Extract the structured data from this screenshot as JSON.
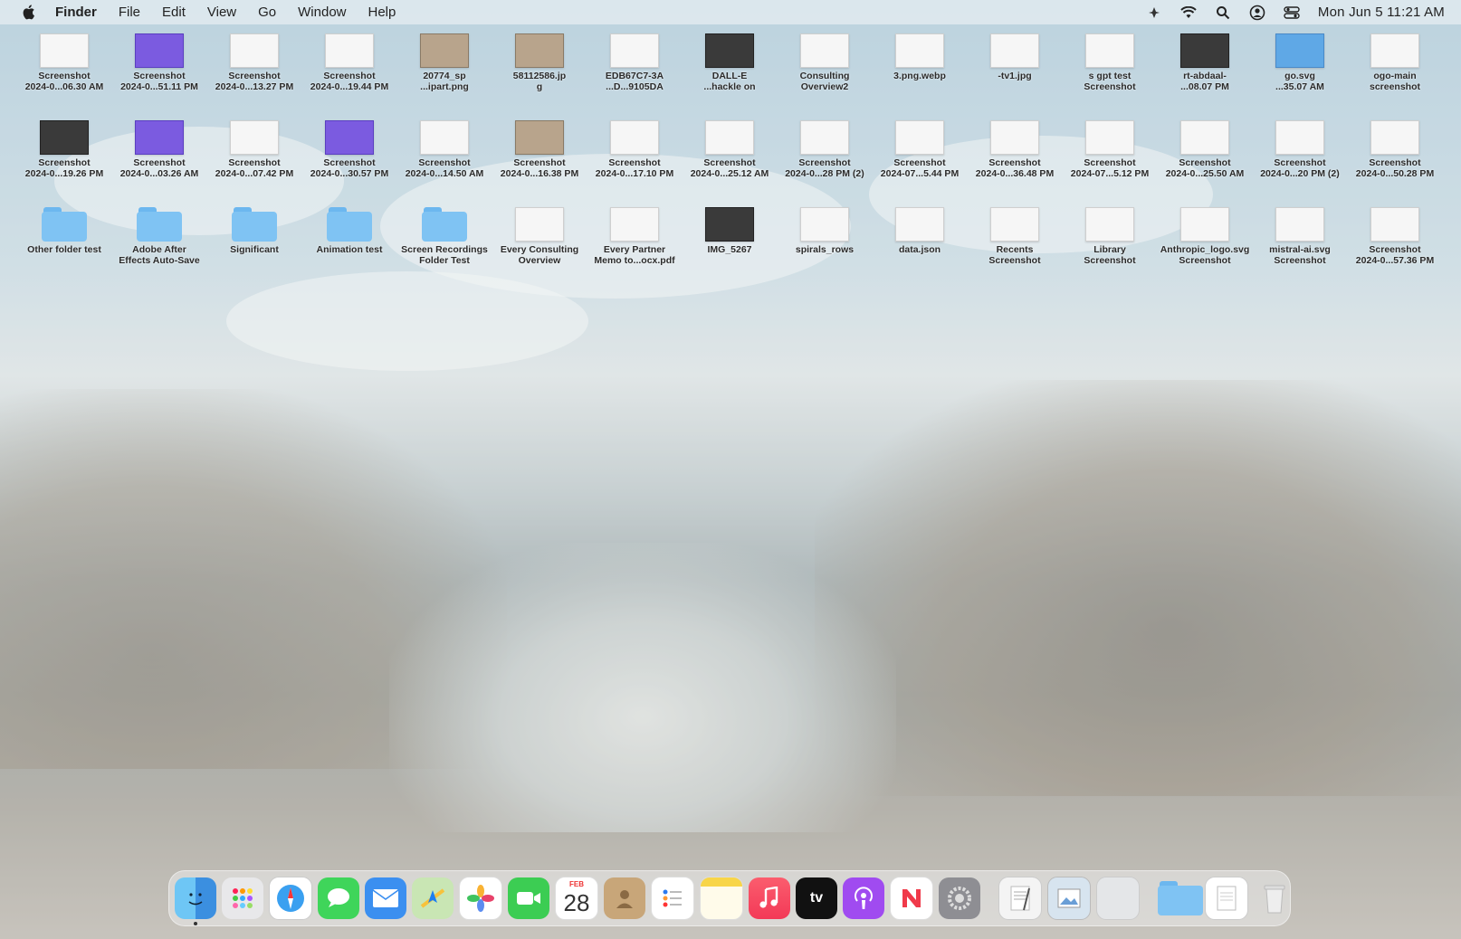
{
  "menubar": {
    "menus": [
      "Finder",
      "File",
      "Edit",
      "View",
      "Go",
      "Window",
      "Help"
    ],
    "clock": "Mon Jun 5  11:21 AM",
    "status_icons": [
      "airdrop-icon",
      "wifi-icon",
      "search-icon",
      "user-icon",
      "control-center-icon"
    ]
  },
  "desktop": {
    "items": [
      {
        "label": "Screenshot\n2024-0...06.30 AM",
        "kind": "thumb"
      },
      {
        "label": "Screenshot\n2024-0...51.11 PM",
        "kind": "purple"
      },
      {
        "label": "Screenshot\n2024-0...13.27 PM",
        "kind": "thumb"
      },
      {
        "label": "Screenshot\n2024-0...19.44 PM",
        "kind": "thumb"
      },
      {
        "label": "20774_sp\n...ipart.png",
        "kind": "photo"
      },
      {
        "label": "58112586.jp\ng",
        "kind": "photo"
      },
      {
        "label": "EDB67C7-3A\n...D...9105DA",
        "kind": "thumb"
      },
      {
        "label": "DALL-E\n...hackle on",
        "kind": "dark"
      },
      {
        "label": "Consulting\nOverview2",
        "kind": "thumb"
      },
      {
        "label": "3.png.webp",
        "kind": "thumb"
      },
      {
        "label": "-tv1.jpg",
        "kind": "thumb"
      },
      {
        "label": "s gpt test\nScreenshot",
        "kind": "thumb"
      },
      {
        "label": "rt-abdaal-\n...08.07 PM",
        "kind": "dark"
      },
      {
        "label": "go.svg\n...35.07 AM",
        "kind": "blue"
      },
      {
        "label": "ogo-main\nscreenshot",
        "kind": "thumb"
      },
      {
        "label": "Screenshot\n2024-0...19.26 PM",
        "kind": "dark"
      },
      {
        "label": "Screenshot\n2024-0...03.26 AM",
        "kind": "purple"
      },
      {
        "label": "Screenshot\n2024-0...07.42 PM",
        "kind": "thumb"
      },
      {
        "label": "Screenshot\n2024-0...30.57 PM",
        "kind": "purple"
      },
      {
        "label": "Screenshot\n2024-0...14.50 AM",
        "kind": "thumb"
      },
      {
        "label": "Screenshot\n2024-0...16.38 PM",
        "kind": "photo"
      },
      {
        "label": "Screenshot\n2024-0...17.10 PM",
        "kind": "thumb"
      },
      {
        "label": "Screenshot\n2024-0...25.12 AM",
        "kind": "thumb"
      },
      {
        "label": "Screenshot\n2024-0...28 PM (2)",
        "kind": "thumb"
      },
      {
        "label": "Screenshot\n2024-07...5.44 PM",
        "kind": "thumb"
      },
      {
        "label": "Screenshot\n2024-0...36.48 PM",
        "kind": "thumb"
      },
      {
        "label": "Screenshot\n2024-07...5.12 PM",
        "kind": "thumb"
      },
      {
        "label": "Screenshot\n2024-0...25.50 AM",
        "kind": "thumb"
      },
      {
        "label": "Screenshot\n2024-0...20 PM (2)",
        "kind": "thumb"
      },
      {
        "label": "Screenshot\n2024-0...50.28 PM",
        "kind": "thumb"
      },
      {
        "label": "Other folder test",
        "kind": "folder"
      },
      {
        "label": "Adobe After\nEffects Auto-Save",
        "kind": "folder"
      },
      {
        "label": "Significant",
        "kind": "folder"
      },
      {
        "label": "Animation test",
        "kind": "folder"
      },
      {
        "label": "Screen Recordings\nFolder Test",
        "kind": "folder"
      },
      {
        "label": "Every Consulting\nOverview",
        "kind": "thumb"
      },
      {
        "label": "Every Partner\nMemo to...ocx.pdf",
        "kind": "thumb"
      },
      {
        "label": "IMG_5267",
        "kind": "dark"
      },
      {
        "label": "spirals_rows",
        "kind": "thumb"
      },
      {
        "label": "data.json",
        "kind": "thumb"
      },
      {
        "label": "Recents\nScreenshot",
        "kind": "thumb"
      },
      {
        "label": "Library\nScreenshot",
        "kind": "thumb"
      },
      {
        "label": "Anthropic_logo.svg\nScreenshot",
        "kind": "thumb"
      },
      {
        "label": "mistral-ai.svg\nScreenshot",
        "kind": "thumb"
      },
      {
        "label": "Screenshot\n2024-0...57.36 PM",
        "kind": "thumb"
      }
    ]
  },
  "dock": {
    "apps": [
      {
        "name": "finder",
        "running": true
      },
      {
        "name": "launchpad"
      },
      {
        "name": "safari"
      },
      {
        "name": "messages"
      },
      {
        "name": "mail"
      },
      {
        "name": "maps"
      },
      {
        "name": "photos"
      },
      {
        "name": "facetime"
      },
      {
        "name": "calendar",
        "month": "FEB",
        "day": "28"
      },
      {
        "name": "contacts"
      },
      {
        "name": "reminders"
      },
      {
        "name": "notes"
      },
      {
        "name": "music"
      },
      {
        "name": "tv",
        "text": "tv"
      },
      {
        "name": "podcasts"
      },
      {
        "name": "news"
      },
      {
        "name": "system-settings"
      }
    ],
    "right": [
      "textedit",
      "preview",
      "blank-app",
      "downloads-folder",
      "document",
      "trash"
    ]
  }
}
